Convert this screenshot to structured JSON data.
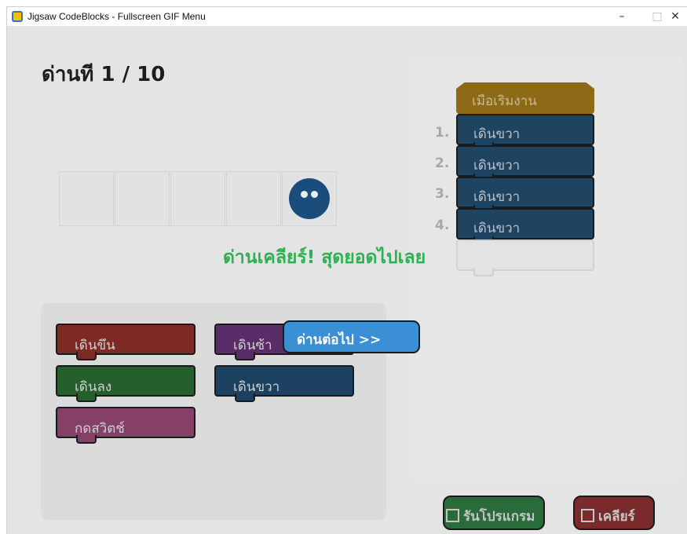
{
  "window": {
    "title": "Jigsaw CodeBlocks - Fullscreen GIF Menu",
    "minimize": "–",
    "maximize": "□",
    "close": "✕"
  },
  "level": {
    "text": "ด่านที 1 / 10"
  },
  "palette": {
    "blocks": [
      {
        "label": "เดินขึน",
        "color": "#7c2a23"
      },
      {
        "label": "เดินซ้า",
        "color": "#5a2d68"
      },
      {
        "label": "เดินลง",
        "color": "#255f2c"
      },
      {
        "label": "เดินขวา",
        "color": "#1d4160"
      },
      {
        "label": "กดสวิตช์",
        "color": "#863f67"
      }
    ]
  },
  "program": {
    "start_label": "เมือเริมงาน",
    "steps": [
      {
        "num": "1.",
        "label": "เดินขวา"
      },
      {
        "num": "2.",
        "label": "เดินขวา"
      },
      {
        "num": "3.",
        "label": "เดินขวา"
      },
      {
        "num": "4.",
        "label": "เดินขวา"
      }
    ]
  },
  "buttons": {
    "run": "รันโปรแกรม",
    "clear": "เคลียร์"
  },
  "overlay": {
    "message": "ด่านเคลียร์! สุดยอดไปเลย",
    "next": "ด่านต่อไป >>"
  },
  "colors": {
    "success": "#2fb052",
    "next_button": "#3b8fd4",
    "robot": "#1b4d7c"
  }
}
